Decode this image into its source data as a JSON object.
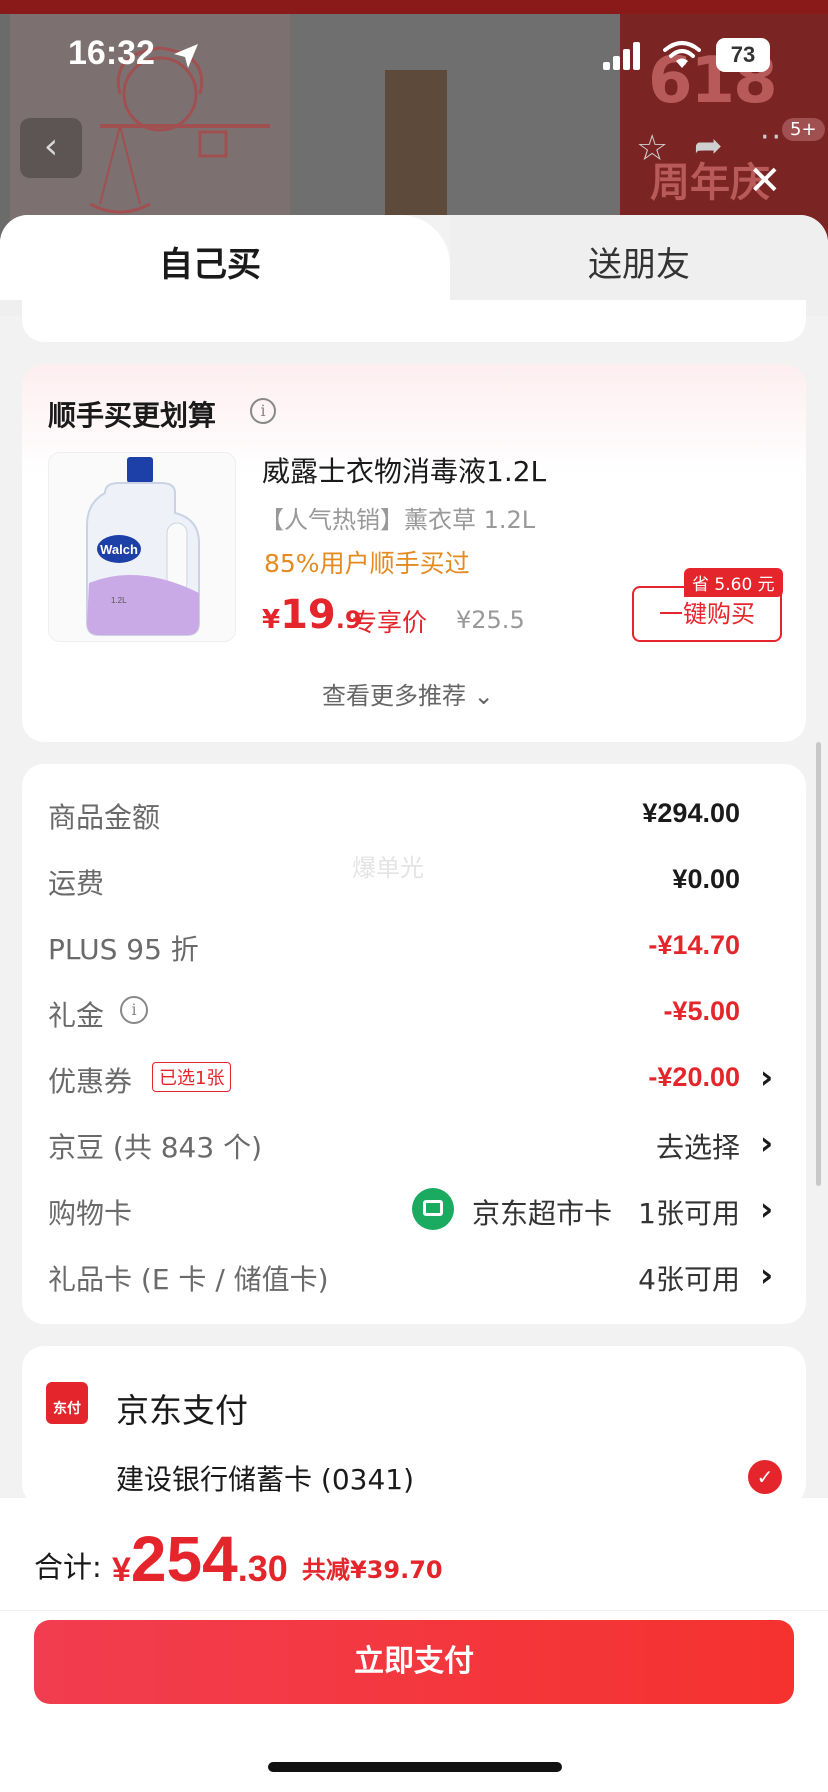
{
  "status_bar": {
    "time": "16:32",
    "battery": "73"
  },
  "header": {
    "back_icon": "‹",
    "more_badge": "5+",
    "promo_number": "618",
    "promo_text": "周年庆"
  },
  "tabs": {
    "self": "自己买",
    "friend": "送朋友"
  },
  "recommendation": {
    "title": "顺手买更划算",
    "product": {
      "name": "威露士衣物消毒液1.2L",
      "subtitle": "【人气热销】薰衣草 1.2L",
      "rate_text": "85%用户顺手买过",
      "price_symbol": "¥",
      "price_int": "19",
      "price_dec": ".9",
      "price_tag": "专享价",
      "old_price": "¥25.5",
      "save_badge": "省 5.60 元",
      "buy_button": "一键购买",
      "image_brand": "Walch",
      "image_volume": "1.2L"
    },
    "more_link": "查看更多推荐"
  },
  "summary": {
    "watermark": "爆单光",
    "rows": [
      {
        "label": "商品金额",
        "value": "¥294.00"
      },
      {
        "label": "运费",
        "value": "¥0.00"
      },
      {
        "label": "PLUS 95 折",
        "value": "-¥14.70"
      },
      {
        "label": "礼金",
        "value": "-¥5.00"
      },
      {
        "label": "优惠券",
        "badge": "已选1张",
        "value": "-¥20.00"
      },
      {
        "label": "京豆 (共 843 个)",
        "value": "去选择"
      },
      {
        "label": "购物卡",
        "card_name": "京东超市卡",
        "value": "1张可用"
      },
      {
        "label": "礼品卡 (E 卡 / 储值卡)",
        "value": "4张可用"
      }
    ]
  },
  "payment": {
    "logo_text": "东付",
    "title": "京东支付",
    "method": "建设银行储蓄卡 (0341)"
  },
  "footer": {
    "total_label": "合计:",
    "total_symbol": "¥",
    "total_int": "254",
    "total_dec": ".30",
    "saving": "共减¥39.70",
    "pay_button": "立即支付"
  },
  "colors": {
    "accent": "#e4262c",
    "orange": "#e48a1f",
    "green": "#1aaa60"
  }
}
